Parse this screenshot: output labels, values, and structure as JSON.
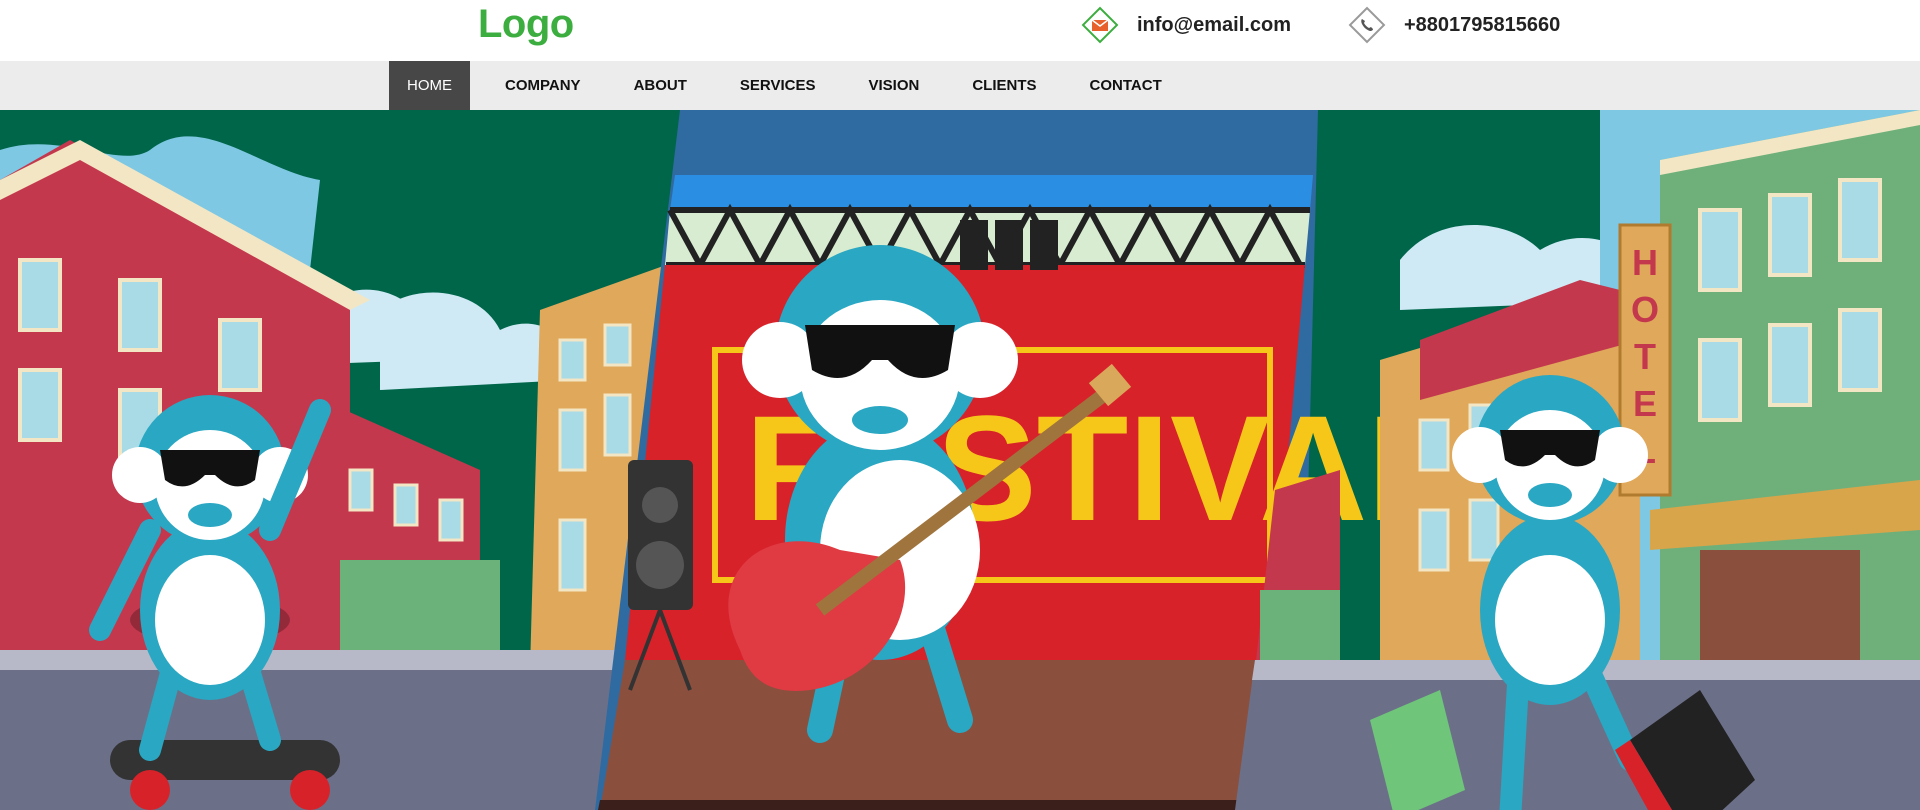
{
  "header": {
    "logo": "Logo",
    "email": {
      "icon": "envelope-icon",
      "text": "info@email.com"
    },
    "phone": {
      "icon": "phone-icon",
      "text": "+8801795815660"
    }
  },
  "nav": {
    "items": [
      {
        "label": "HOME",
        "active": true
      },
      {
        "label": "COMPANY",
        "active": false
      },
      {
        "label": "ABOUT",
        "active": false
      },
      {
        "label": "SERVICES",
        "active": false
      },
      {
        "label": "VISION",
        "active": false
      },
      {
        "label": "CLIENTS",
        "active": false
      },
      {
        "label": "CONTACT",
        "active": false
      }
    ]
  },
  "hero": {
    "banner_text": "FESTIVAL",
    "sign_text": "HOTEL"
  },
  "colors": {
    "brand_green": "#3cae3f",
    "nav_active_bg": "#474747",
    "nav_bg": "#ececec",
    "monkey_blue": "#2aa7c2"
  }
}
